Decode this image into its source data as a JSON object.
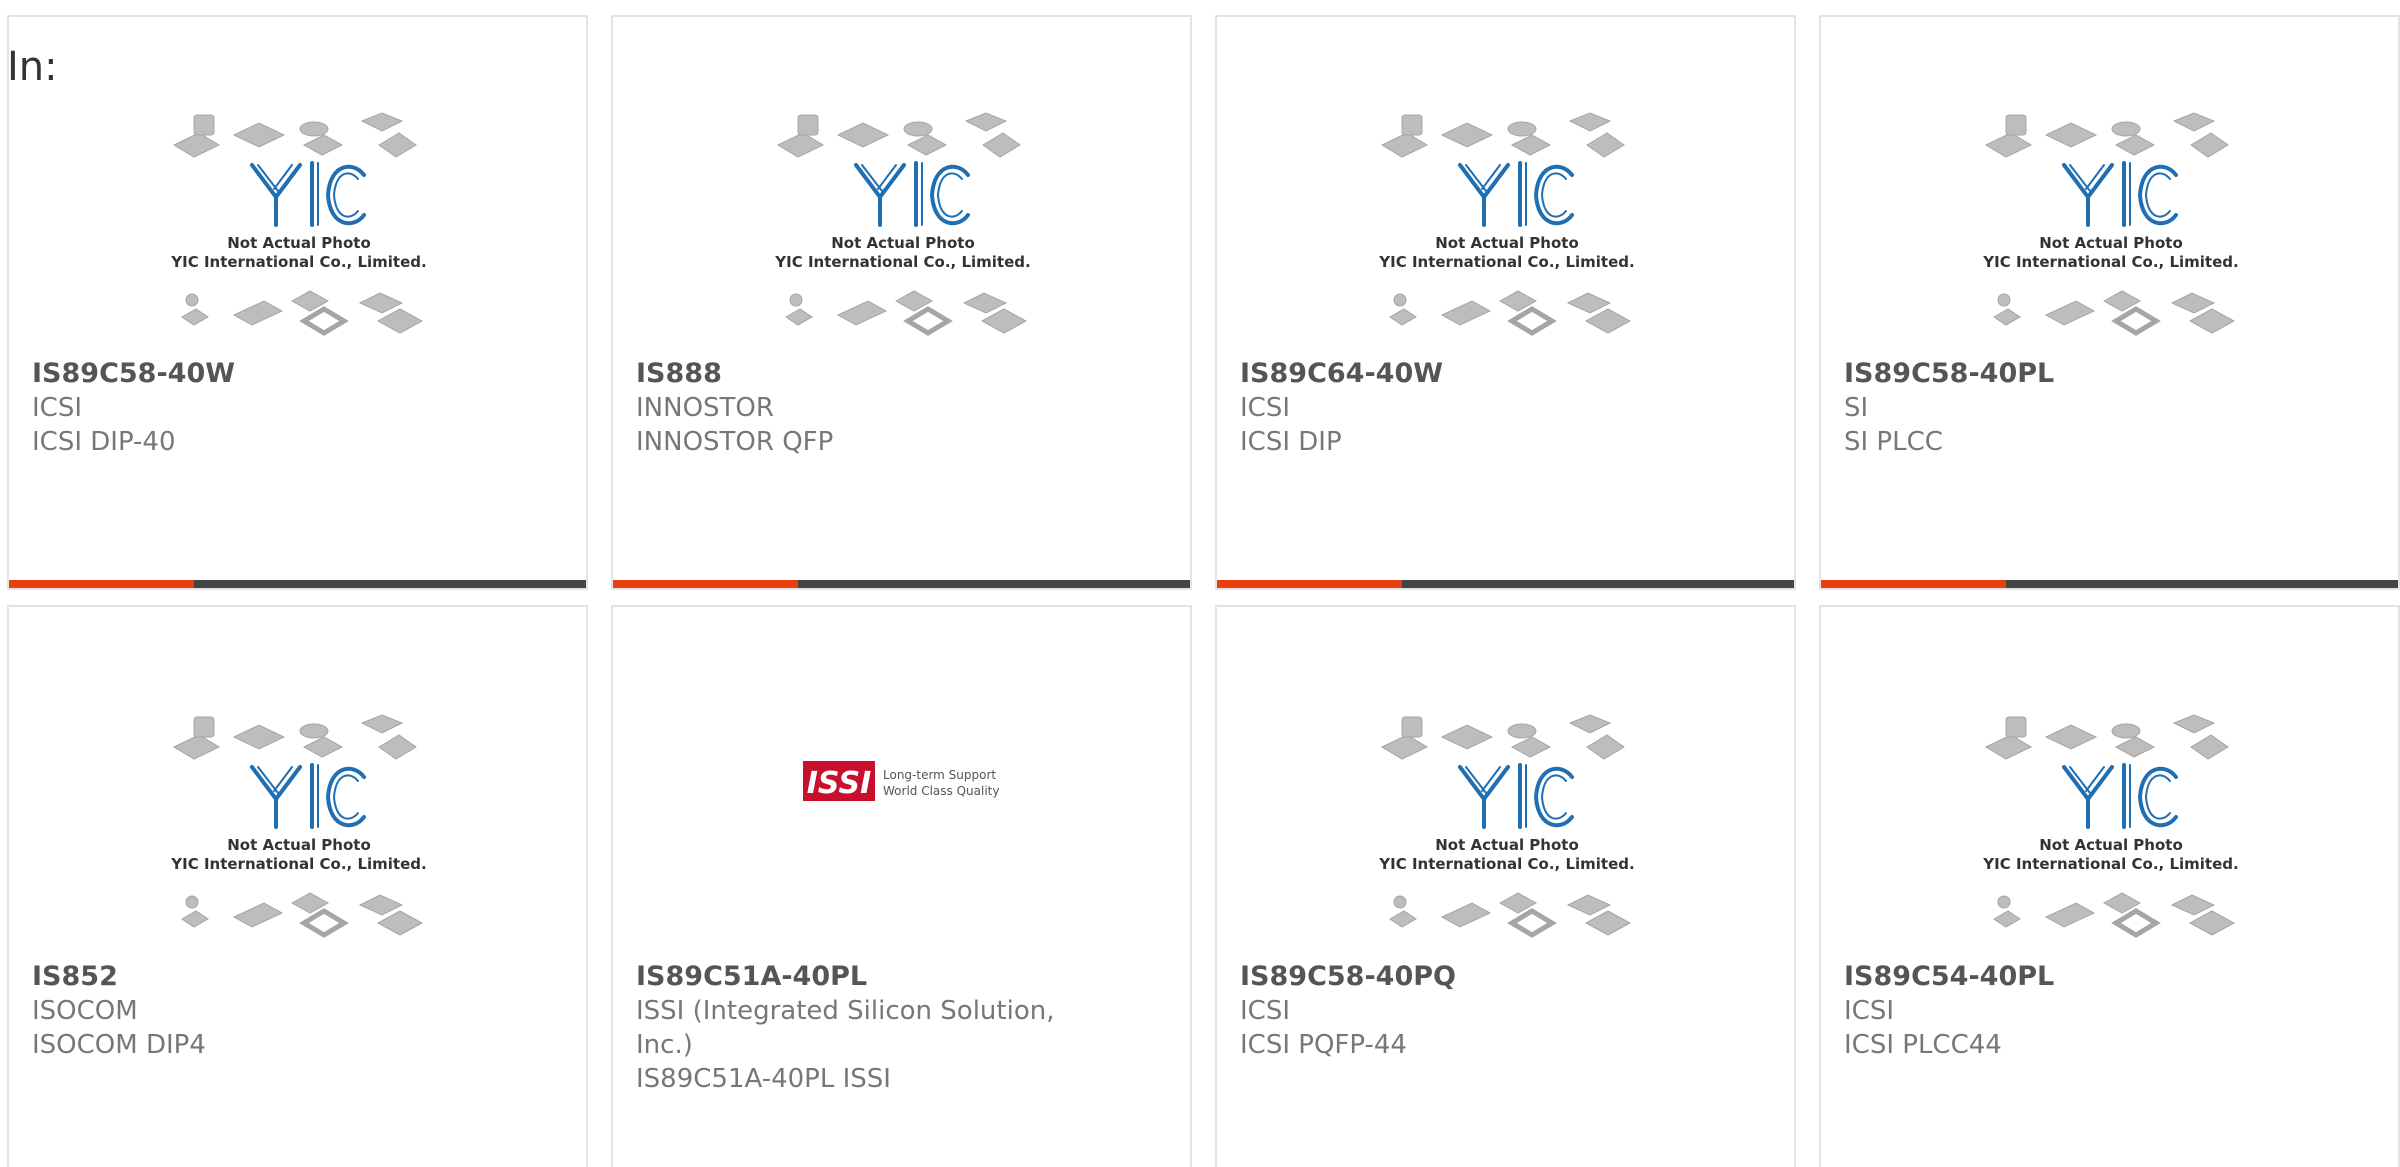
{
  "header": {
    "filter_label": "In:"
  },
  "placeholder": {
    "line1": "Not Actual Photo",
    "line2": "YIC International Co., Limited."
  },
  "issi_logo": {
    "tagline1": "Long-term Support",
    "tagline2": "World Class Quality"
  },
  "colors": {
    "accent": "#e8400c",
    "bar": "#444444",
    "yic_blue": "#1f6fb2",
    "issi_red": "#c8102e"
  },
  "products": [
    {
      "part_number": "IS89C58-40W",
      "manufacturer": "ICSI",
      "package": "ICSI DIP-40",
      "image": "placeholder"
    },
    {
      "part_number": "IS888",
      "manufacturer": "INNOSTOR",
      "package": "INNOSTOR QFP",
      "image": "placeholder"
    },
    {
      "part_number": "IS89C64-40W",
      "manufacturer": "ICSI",
      "package": "ICSI DIP",
      "image": "placeholder"
    },
    {
      "part_number": "IS89C58-40PL",
      "manufacturer": "SI",
      "package": "SI PLCC",
      "image": "placeholder"
    },
    {
      "part_number": "IS852",
      "manufacturer": "ISOCOM",
      "package": "ISOCOM DIP4",
      "image": "placeholder"
    },
    {
      "part_number": "IS89C51A-40PL",
      "manufacturer": "ISSI (Integrated Silicon Solution, Inc.)",
      "package": "IS89C51A-40PL ISSI",
      "image": "issi-logo"
    },
    {
      "part_number": "IS89C58-40PQ",
      "manufacturer": "ICSI",
      "package": "ICSI PQFP-44",
      "image": "placeholder"
    },
    {
      "part_number": "IS89C54-40PL",
      "manufacturer": "ICSI",
      "package": "ICSI PLCC44",
      "image": "placeholder"
    }
  ]
}
